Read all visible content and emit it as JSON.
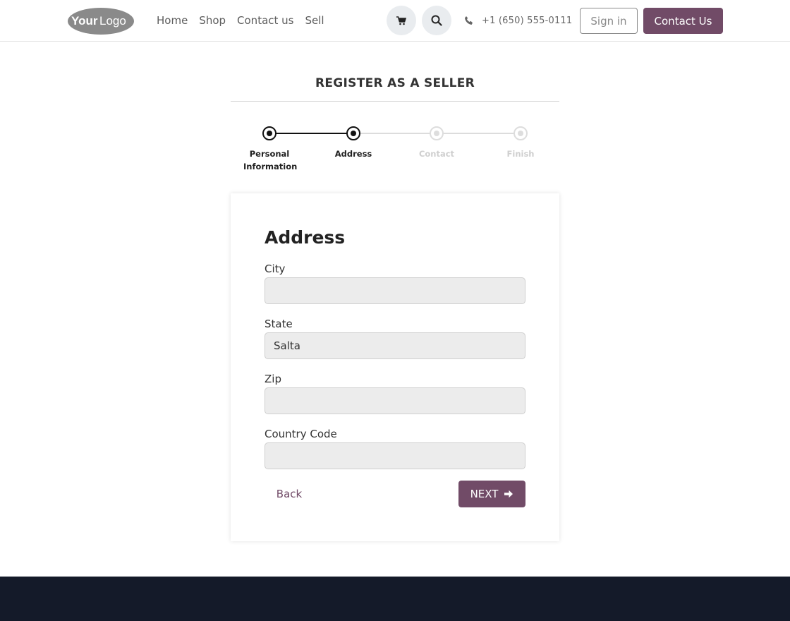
{
  "header": {
    "logo_text": "YourLogo",
    "nav": [
      "Home",
      "Shop",
      "Contact us",
      "Sell"
    ],
    "icons": {
      "cart": "cart-icon",
      "search": "search-icon",
      "phone": "phone-icon"
    },
    "phone": "+1 (650) 555-0111",
    "signin_label": "Sign in",
    "contact_label": "Contact Us"
  },
  "page": {
    "title": "REGISTER AS A SELLER"
  },
  "stepper": {
    "steps": [
      {
        "label": "Personal Information",
        "state": "done"
      },
      {
        "label": "Address",
        "state": "active"
      },
      {
        "label": "Contact",
        "state": "inactive"
      },
      {
        "label": "Finish",
        "state": "inactive"
      }
    ]
  },
  "form": {
    "title": "Address",
    "fields": [
      {
        "label": "City",
        "value": ""
      },
      {
        "label": "State",
        "value": "Salta"
      },
      {
        "label": "Zip",
        "value": ""
      },
      {
        "label": "Country Code",
        "value": ""
      }
    ],
    "back_label": "Back",
    "next_label": "NEXT"
  },
  "colors": {
    "accent": "#714b67",
    "footer": "#141a29"
  }
}
